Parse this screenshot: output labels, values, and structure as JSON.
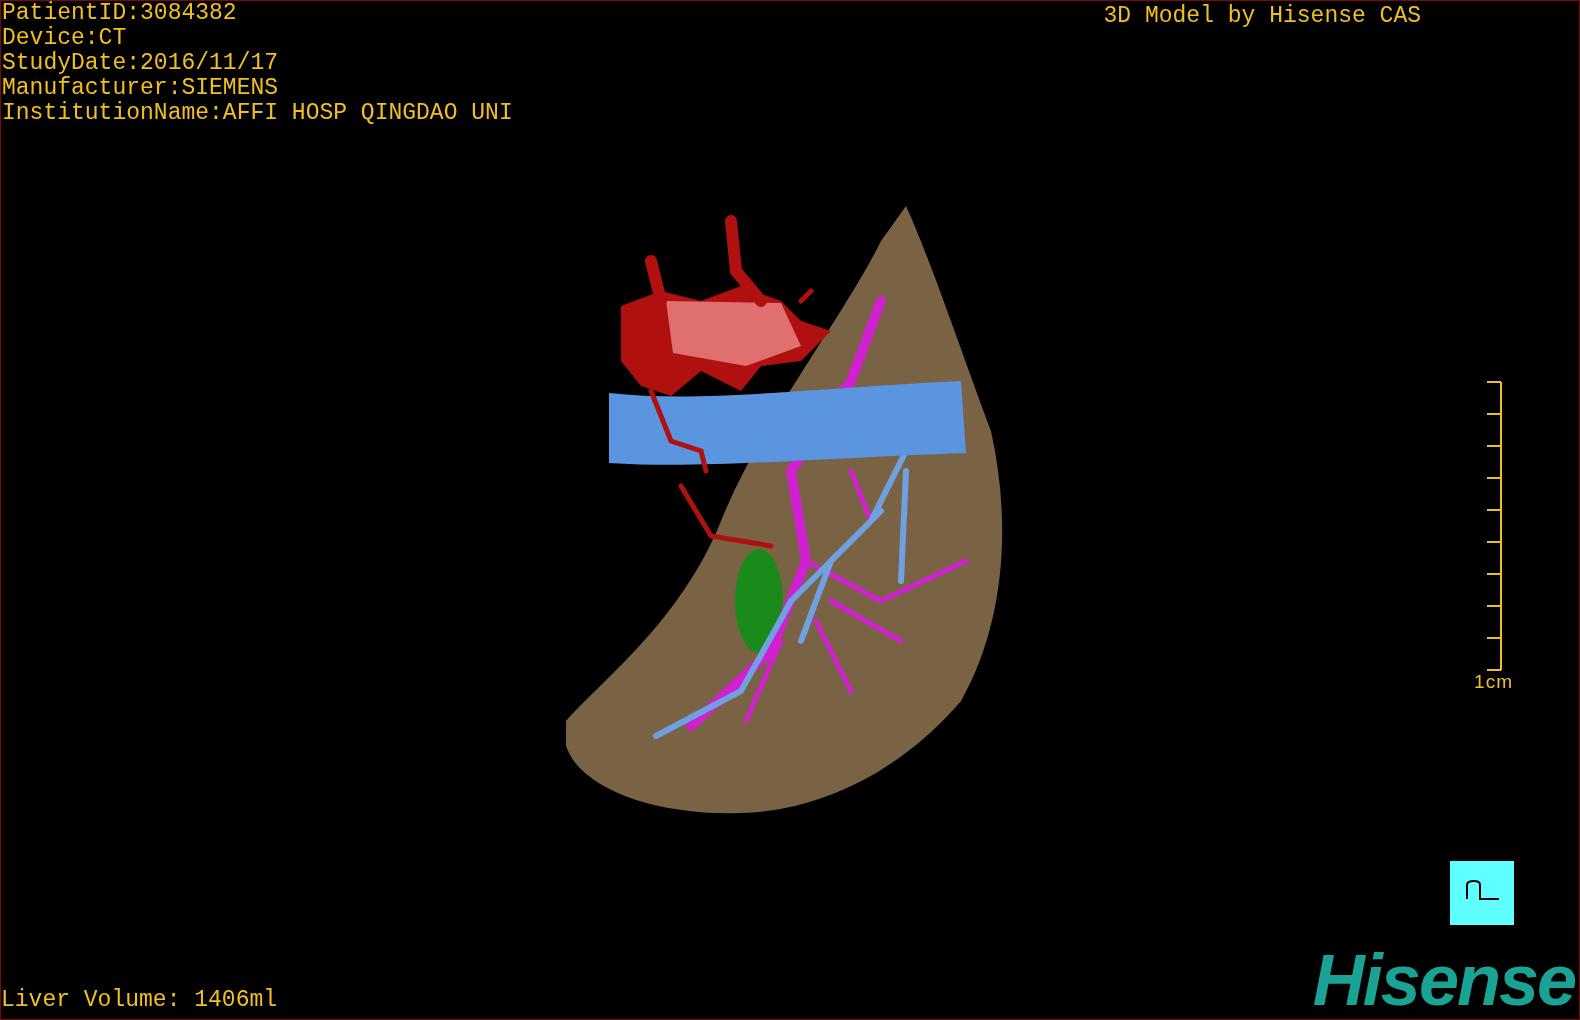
{
  "info_lines": [
    "PatientID:3084382",
    "Device:CT",
    "StudyDate:2016/11/17",
    "Manufacturer:SIEMENS",
    "InstitutionName:AFFI HOSP QINGDAO UNI"
  ],
  "title": "3D Model by Hisense CAS",
  "scale": {
    "label": "1cm"
  },
  "footer": {
    "volume": "Liver Volume: 1406ml",
    "logo": "Hisense"
  }
}
